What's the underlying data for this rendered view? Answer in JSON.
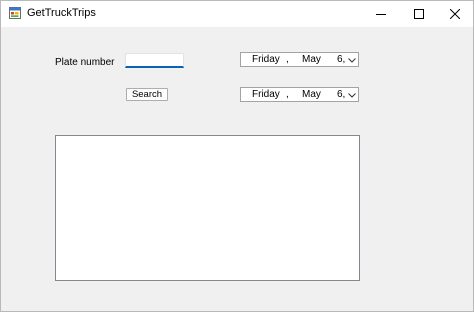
{
  "window": {
    "title": "GetTruckTrips",
    "icon": "windows-form-icon"
  },
  "titlebar_controls": {
    "minimize_icon": "minimize-icon",
    "maximize_icon": "maximize-icon",
    "close_icon": "close-icon"
  },
  "form": {
    "plate_label": "Plate number",
    "plate_value": "",
    "search_label": "Search",
    "date_from": {
      "day": "Friday",
      "separator": ",",
      "month": "May",
      "date": "6,"
    },
    "date_to": {
      "day": "Friday",
      "separator": ",",
      "month": "May",
      "date": "6,"
    },
    "results": []
  },
  "colors": {
    "focus_underline": "#0a62b4",
    "client_background": "#f0f0f0"
  }
}
